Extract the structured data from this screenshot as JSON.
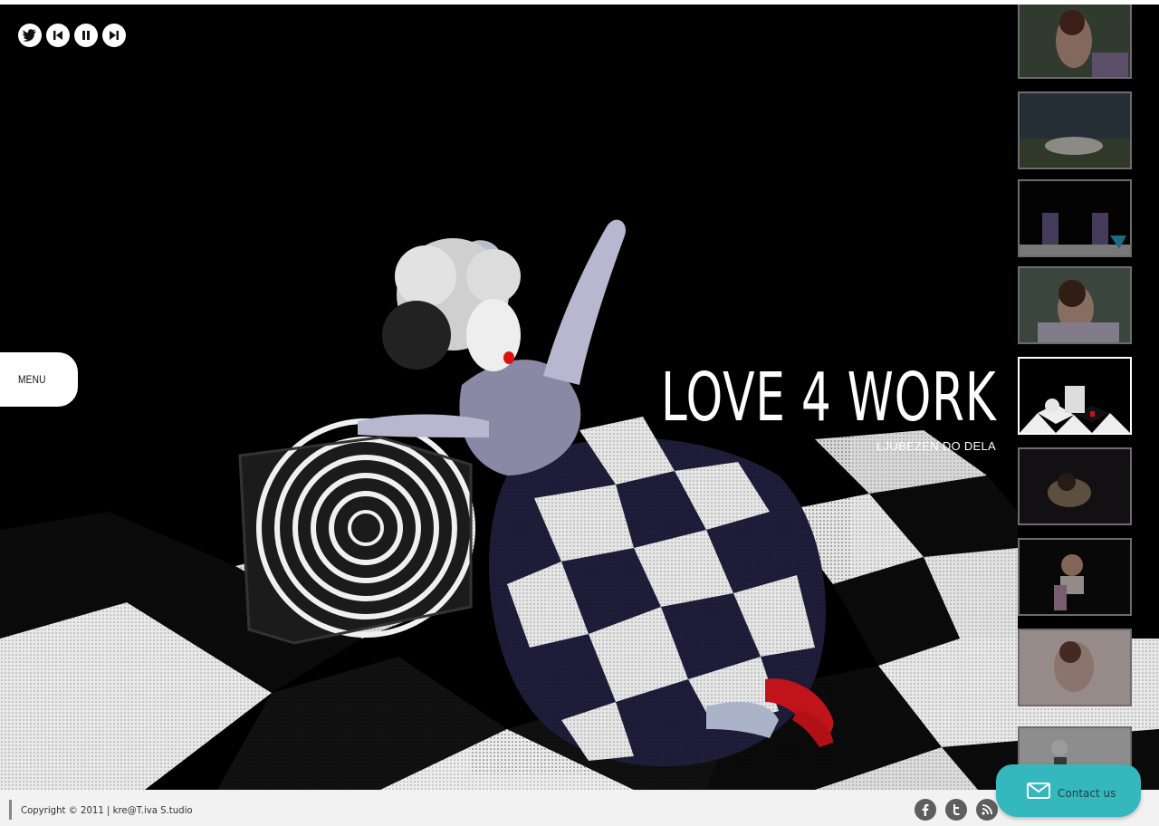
{
  "controls": {
    "twitter": "twitter-bird-icon",
    "prev": "skip-previous-icon",
    "pause": "pause-icon",
    "next": "skip-next-icon"
  },
  "menu": {
    "label": "MENU"
  },
  "slide": {
    "title": "LOVE 4 WORK",
    "subtitle": "LJUBEZEN DO DELA"
  },
  "thumbnails": [
    {
      "scene": "woman-with-crown-flowers",
      "active": false
    },
    {
      "scene": "woman-lying-in-field",
      "active": false
    },
    {
      "scene": "checkered-dancers",
      "active": false
    },
    {
      "scene": "woman-with-tiara",
      "active": false
    },
    {
      "scene": "checkered-floor-pose",
      "active": true
    },
    {
      "scene": "woman-in-dark",
      "active": false
    },
    {
      "scene": "woman-sitting-box",
      "active": false
    },
    {
      "scene": "woman-pale-portrait",
      "active": false
    },
    {
      "scene": "woman-standing-floor",
      "active": false
    }
  ],
  "footer": {
    "copyright": "Copyright © 2011 | kre@T.iva S.tudio",
    "social": [
      "facebook-icon",
      "twitter-icon",
      "rss-icon"
    ]
  },
  "contact": {
    "label": "Contact us",
    "icon": "envelope-icon"
  },
  "colors": {
    "accent": "#35b8bd",
    "stage": "#000000",
    "footer": "#f2f2f2"
  }
}
